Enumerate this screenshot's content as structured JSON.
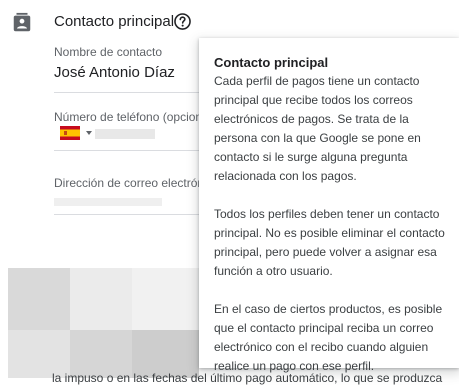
{
  "section": {
    "icon": "contact-card-icon",
    "title": "Contacto principal",
    "help_icon": "help-circle-icon"
  },
  "contact_name": {
    "label": "Nombre de contacto",
    "value": "José Antonio Díaz"
  },
  "phone": {
    "label": "Número de teléfono (opcional)",
    "country_flag": "spain-flag-icon",
    "dropdown_icon": "caret-down-icon"
  },
  "email": {
    "label": "Dirección de correo electrónico"
  },
  "tooltip": {
    "title": "Contacto principal",
    "paragraphs": [
      "Cada perfil de pagos tiene un contacto principal que recibe todos los correos electrónicos de pagos. Se trata de la persona con la que Google se pone en contacto si le surge alguna pregunta relacionada con los pagos.",
      "Todos los perfiles deben tener un contacto principal. No es posible eliminar el contacto principal, pero puede volver a asignar esa función a otro usuario.",
      "En el caso de ciertos productos, es posible que el contacto principal reciba un correo electrónico con el recibo cuando alguien realice un pago con ese perfil."
    ]
  },
  "footer_text": "la impuso o en las fechas del último pago automático, lo que se produzca",
  "colors": {
    "text_primary": "#202124",
    "text_secondary": "#5f6368",
    "divider": "#dadce0",
    "flag_red": "#c60b1e",
    "flag_yellow": "#ffc400"
  }
}
